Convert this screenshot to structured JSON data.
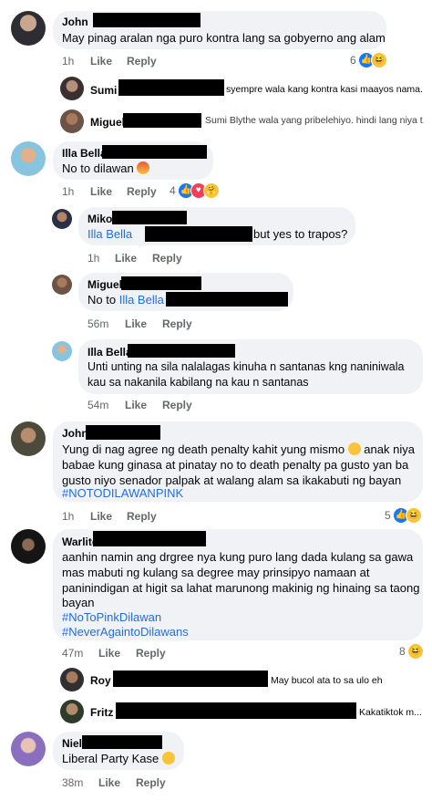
{
  "actions": {
    "like": "Like",
    "reply": "Reply"
  },
  "colors": {
    "bubble": "#f0f2f5",
    "link": "#216fdb",
    "meta": "#65676b",
    "like_blue": "#1877f2"
  },
  "comments": [
    {
      "name": "John",
      "text": "May pinag aralan nga puro kontra lang sa gobyerno ang alam",
      "time": "1h",
      "react_count": "6",
      "replies": [
        {
          "name": "Sumi",
          "snippet": "syempre wala kang kontra kasi maayos nama..."
        },
        {
          "name": "Miguel",
          "snippet": "Sumi Blythe wala yang pribelehiyo. hindi lang niya t..."
        }
      ]
    },
    {
      "name": "Illa Bella",
      "text": "No to dilawan",
      "time": "1h",
      "react_count": "4"
    },
    {
      "name": "Miko",
      "tag": "Illa Bella",
      "text": "but yes to trapos?",
      "time": "1h"
    },
    {
      "name": "Miguel",
      "prefix": "No to",
      "tag": "Illa Bella",
      "time": "56m"
    },
    {
      "name": "Illa Bella",
      "lines": [
        "Unti unting na sila nalalagas kinuha n santanas kng naniniwala",
        "kau sa nakanila kabilang na kau n santanas"
      ],
      "time": "54m"
    },
    {
      "name": "John",
      "lines": [
        "Yung di nag agree ng death penalty kahit yung mismo",
        "anak niya",
        "babae kung ginasa at pinatay no to death penalty pa gusto yan ba",
        "gusto niyo senador palpak at walang alam sa ikakabuti ng bayan"
      ],
      "hashtag": "#NOTODILAWANPINK",
      "time": "1h",
      "react_count": "5"
    },
    {
      "name": "Warlito",
      "lines": [
        "aanhin namin ang drgree nya kung puro lang dada kulang sa gawa",
        "mas mabuti ng kulang sa degree may prinsipyo namaan at",
        "paninindigan at higit sa lahat marunong makinig ng hinaing sa taong",
        "bayan"
      ],
      "hashtags": [
        "#NoToPinkDilawan",
        "#NeverAgaintoDilawans"
      ],
      "time": "47m",
      "react_count": "8",
      "replies": [
        {
          "name": "Roy",
          "snippet": "May bucol ata to sa ulo eh"
        },
        {
          "name": "Fritz",
          "snippet": "Kakatiktok m..."
        }
      ]
    },
    {
      "name": "Niel",
      "text": "Liberal Party Kase",
      "time": "38m"
    }
  ]
}
